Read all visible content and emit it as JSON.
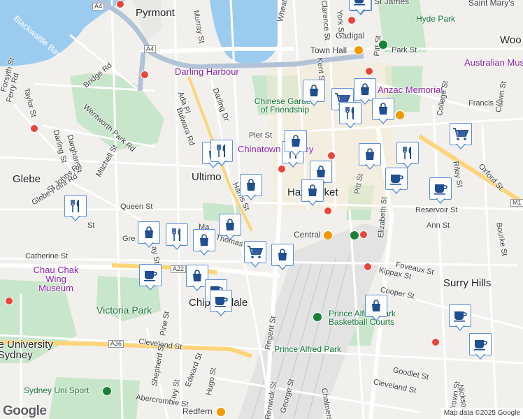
{
  "labels": {
    "pyrmont": "Pyrmont",
    "blackwattle_bay": "Blackwattle Bay",
    "ultimo": "Ultimo",
    "glebe": "Glebe",
    "haymarket": "Haymarket",
    "chippendale": "Chippendale",
    "surry_hills": "Surry Hills",
    "woolloomooloo": "Woo",
    "darling_harbour": "Darling Harbour",
    "chinese_garden": "Chinese Garden of Friendship",
    "chinatown": "Chinatown Sydney",
    "town_hall": "Town Hall",
    "gadigal": "Gadigal",
    "hyde_park": "Hyde Park",
    "australian_museum": "Australian Museum",
    "anzac_memorial": "Anzac Memorial",
    "saint_marys": "Saint Mary's",
    "st_james": "St James",
    "central": "Central",
    "chau_chak": "Chau Chak Wing Museum",
    "victoria_park": "Victoria Park",
    "university_sydney": "The University of Sydney",
    "prince_alfred_courts": "Prince Alfred Park Basketball Courts",
    "prince_alfred_park": "Prince Alfred Park",
    "sydney_uni_sport": "Sydney Uni Sport",
    "redfern": "Redfern"
  },
  "streets": {
    "a4": "A4",
    "a22": "A22",
    "a36": "A36",
    "m1": "M1",
    "bridge_rd": "Bridge Rd",
    "wentworth_park_rd": "Wentworth Park Rd",
    "glebe_point_rd": "Glebe Point Rd",
    "st_johns_rd": "St Johns Rd",
    "mitchell_st": "Mitchell St",
    "darling_st": "Darling St",
    "darghan_st": "Darghan St",
    "ferry_rd": "Ferry Rd",
    "taylor_st": "Taylor St",
    "forsyth_st": "Forsyth St",
    "catherine_st": "Catherine St",
    "queen_st": "Queen St",
    "harris_st": "Harris St",
    "bulwara_rd": "Bulwara Rd",
    "ada_pl": "Ada Pl",
    "darling_dr": "Darling Dr",
    "murray_st": "Murray St",
    "wheat_rd": "Wheat Rd",
    "pier_st": "Pier St",
    "kent_st": "Kent St",
    "clarence_st": "Clarence St",
    "york_st": "York St",
    "pitt_st": "Pitt St",
    "park_st": "Park St",
    "elizabeth_st": "Elizabeth St",
    "college_st": "College St",
    "crown_st": "Crown St",
    "francis_st": "Francis St",
    "oxford_st": "Oxford St",
    "riley_st": "Riley St",
    "reservoir_st": "Reservoir St",
    "ann_st": "Ann St",
    "bourke_st": "Bourke St",
    "foveaux_st": "Foveaux St",
    "kippax_st": "Kippax St",
    "cooper_st": "Cooper St",
    "goodlet_st": "Goodlet St",
    "cleveland_st": "Cleveland St",
    "cleveland_st2": "Cleveland St",
    "regent_st": "Regent St",
    "george_st": "George St",
    "renwick_st": "Renwick St",
    "chalmers_st": "Chalmers St",
    "shepherd_st": "Shepherd St",
    "pine_st": "Pine St",
    "ivy_st": "Ivy St",
    "edward_st": "Edward St",
    "hugo_st": "Hugo St",
    "abercrombie_st": "Abercrombie St",
    "crown_st2": "Crown St",
    "nickson_st": "Nickson St",
    "wattle_st": "St",
    "thomas_st": "Thomas St",
    "greek_st": "Gre",
    "bay_st": "ay St",
    "mary_st": "Ma"
  },
  "markers": [
    {
      "kind": "shopping",
      "icon": "shopping-bag-icon"
    },
    {
      "kind": "cafe",
      "icon": "coffee-cup-icon"
    },
    {
      "kind": "shopping",
      "icon": "shopping-bag-icon"
    },
    {
      "kind": "shopping",
      "icon": "shopping-bag-icon"
    },
    {
      "kind": "grocery",
      "icon": "shopping-cart-icon"
    },
    {
      "kind": "restaurant",
      "icon": "fork-knife-icon"
    },
    {
      "kind": "shopping",
      "icon": "shopping-bag-icon"
    },
    {
      "kind": "shopping",
      "icon": "shopping-bag-icon"
    },
    {
      "kind": "restaurant",
      "icon": "fork-knife-icon"
    },
    {
      "kind": "shopping",
      "icon": "shopping-bag-icon"
    },
    {
      "kind": "shopping",
      "icon": "shopping-bag-icon"
    },
    {
      "kind": "grocery",
      "icon": "shopping-cart-icon"
    },
    {
      "kind": "restaurant",
      "icon": "fork-knife-icon"
    },
    {
      "kind": "shopping",
      "icon": "shopping-bag-icon"
    },
    {
      "kind": "shopping",
      "icon": "shopping-bag-icon"
    },
    {
      "kind": "shopping",
      "icon": "shopping-bag-icon"
    },
    {
      "kind": "restaurant",
      "icon": "fork-knife-icon"
    },
    {
      "kind": "cafe",
      "icon": "coffee-cup-icon"
    },
    {
      "kind": "cafe",
      "icon": "coffee-cup-icon"
    },
    {
      "kind": "restaurant",
      "icon": "fork-knife-icon"
    },
    {
      "kind": "shopping",
      "icon": "shopping-bag-icon"
    },
    {
      "kind": "restaurant",
      "icon": "fork-knife-icon"
    },
    {
      "kind": "shopping",
      "icon": "shopping-bag-icon"
    },
    {
      "kind": "shopping",
      "icon": "shopping-bag-icon"
    },
    {
      "kind": "grocery",
      "icon": "shopping-cart-icon"
    },
    {
      "kind": "shopping",
      "icon": "shopping-bag-icon"
    },
    {
      "kind": "cafe",
      "icon": "coffee-cup-icon"
    },
    {
      "kind": "shopping",
      "icon": "shopping-bag-icon"
    },
    {
      "kind": "cafe",
      "icon": "coffee-cup-icon"
    },
    {
      "kind": "cafe",
      "icon": "coffee-cup-icon"
    },
    {
      "kind": "shopping",
      "icon": "shopping-bag-icon"
    },
    {
      "kind": "cafe",
      "icon": "coffee-cup-icon"
    },
    {
      "kind": "cafe",
      "icon": "coffee-cup-icon"
    }
  ],
  "colors": {
    "land": "#f1f0ec",
    "water": "#9ccbf0",
    "park": "#c8e6c9",
    "marker_border": "#5b8fd9",
    "marker_icon": "#1f4e91",
    "motorway": "#b2c3d7"
  },
  "footer": {
    "logo": "Google",
    "attribution": "Map data ©2025 Google"
  }
}
